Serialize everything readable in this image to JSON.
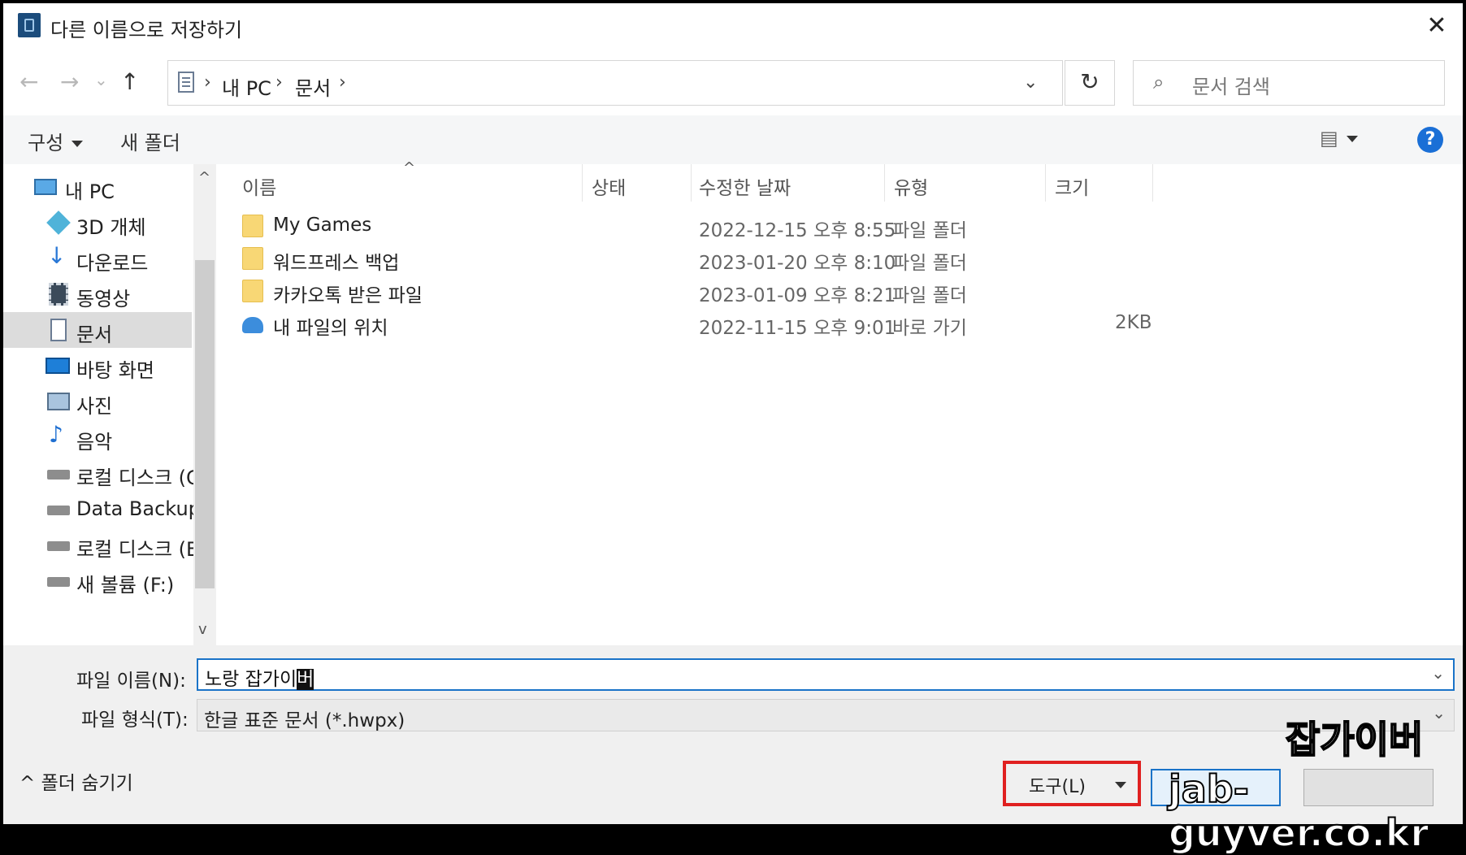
{
  "window": {
    "title": "다른 이름으로 저장하기",
    "close_glyph": "✕"
  },
  "nav": {
    "back_glyph": "←",
    "forward_glyph": "→",
    "recent_glyph": "⌄",
    "up_glyph": "↑",
    "breadcrumb": [
      "내 PC",
      "문서"
    ],
    "breadcrumb_sep": "›",
    "dropdown_glyph": "⌄",
    "refresh_glyph": "↻",
    "search_icon": "search-icon",
    "search_placeholder": "문서 검색"
  },
  "commandbar": {
    "organize_label": "구성",
    "new_folder_label": "새 폴더",
    "view_glyph": "▤",
    "help_glyph": "?"
  },
  "sidebar": {
    "items": [
      {
        "label": "내 PC",
        "icon": "pc-icon"
      },
      {
        "label": "3D 개체",
        "icon": "cube-icon"
      },
      {
        "label": "다운로드",
        "icon": "download-icon"
      },
      {
        "label": "동영상",
        "icon": "video-icon"
      },
      {
        "label": "문서",
        "icon": "document-icon",
        "selected": true
      },
      {
        "label": "바탕 화면",
        "icon": "desktop-icon"
      },
      {
        "label": "사진",
        "icon": "pictures-icon"
      },
      {
        "label": "음악",
        "icon": "music-icon"
      },
      {
        "label": "로컬 디스크 (C:)",
        "icon": "drive-icon"
      },
      {
        "label": "Data Backup (D",
        "icon": "drive-icon"
      },
      {
        "label": "로컬 디스크 (E:)",
        "icon": "drive-icon"
      },
      {
        "label": "새 볼륨 (F:)",
        "icon": "drive-icon"
      }
    ],
    "scroll_up_glyph": "^",
    "scroll_down_glyph": "v"
  },
  "columns": {
    "name": "이름",
    "status": "상태",
    "modified": "수정한 날짜",
    "type": "유형",
    "size": "크기",
    "sort_glyph": "^"
  },
  "files": [
    {
      "name": "My Games",
      "modified": "2022-12-15 오후 8:55",
      "type": "파일 폴더",
      "size": "",
      "icon": "folder-icon"
    },
    {
      "name": "워드프레스 백업",
      "modified": "2023-01-20 오후 8:10",
      "type": "파일 폴더",
      "size": "",
      "icon": "folder-icon"
    },
    {
      "name": "카카오톡 받은 파일",
      "modified": "2023-01-09 오후 8:21",
      "type": "파일 폴더",
      "size": "",
      "icon": "folder-icon"
    },
    {
      "name": "내 파일의 위치",
      "modified": "2022-11-15 오후 9:01",
      "type": "바로 가기",
      "size": "2KB",
      "icon": "cloud-shortcut-icon"
    }
  ],
  "form": {
    "filename_label": "파일 이름(N):",
    "filename_value": "노랑 잡가이",
    "filename_cursor_char": "버",
    "filetype_label": "파일 형식(T):",
    "filetype_value": "한글 표준 문서 (*.hwpx)",
    "combo_glyph": "⌄",
    "hide_folders_label": "폴더 숨기기",
    "hide_folders_glyph": "^",
    "tools_label": "도구(L)"
  },
  "watermark": {
    "line1": "잡가이버",
    "line2": "jab-guyver.co.kr"
  },
  "colors": {
    "accent": "#1a73c8",
    "highlight_box": "#e02020",
    "folder": "#f8d775",
    "help": "#1a6fd6"
  }
}
